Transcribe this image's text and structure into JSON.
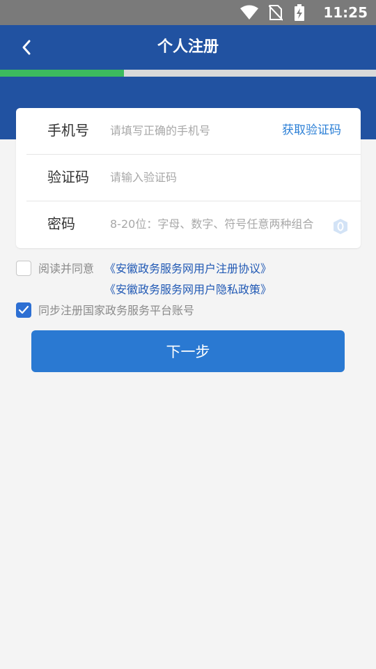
{
  "status_bar": {
    "time": "11:25",
    "icons": [
      "wifi-icon",
      "no-sim-icon",
      "battery-charging-icon"
    ]
  },
  "app_bar": {
    "title": "个人注册",
    "back_icon": "chevron-left-icon"
  },
  "progress": {
    "value": 0.33
  },
  "form": {
    "phone": {
      "label": "手机号",
      "placeholder": "请填写正确的手机号",
      "action": "获取验证码"
    },
    "code": {
      "label": "验证码",
      "placeholder": "请输入验证码"
    },
    "password": {
      "label": "密码",
      "placeholder": "8-20位：字母、数字、符号任意两种组合",
      "toggle_icon": "eye-icon"
    }
  },
  "agreement": {
    "checked": false,
    "prefix": "阅读并同意",
    "link1": "《安徽政务服务网用户注册协议》",
    "link2": "《安徽政务服务网用户隐私政策》"
  },
  "sync": {
    "checked": true,
    "label": "同步注册国家政务服务平台账号"
  },
  "next_button": {
    "label": "下一步"
  },
  "colors": {
    "primary": "#2152a1",
    "button": "#2a79d2",
    "progress": "#3cbb5e",
    "link": "#2159b4"
  }
}
